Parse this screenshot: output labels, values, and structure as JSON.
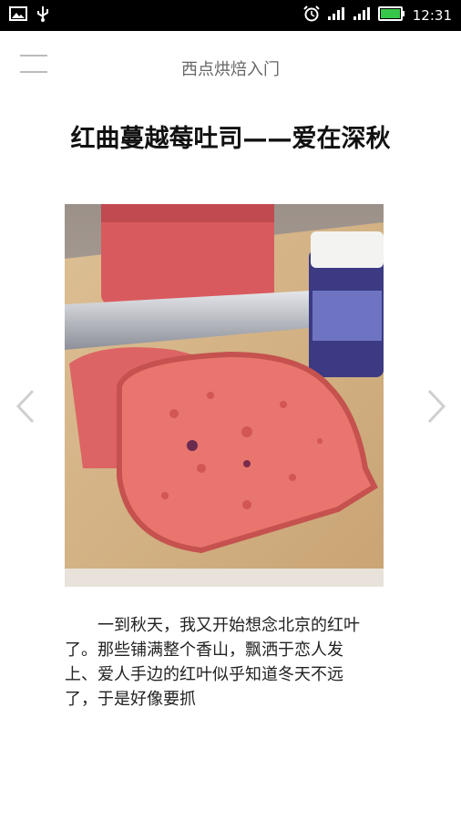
{
  "status_bar": {
    "time": "12:31",
    "icons": [
      "image-icon",
      "usb-icon",
      "alarm-icon",
      "signal-icon",
      "signal-icon",
      "battery-icon"
    ]
  },
  "header": {
    "menu_icon": "hamburger-menu-icon",
    "title": "西点烘焙入门"
  },
  "article": {
    "title": "红曲蔓越莓吐司——爱在深秋",
    "body": "一到秋天，我又开始想念北京的红叶了。那些铺满整个香山，飘洒于恋人发上、爱人手边的红叶似乎知道冬天不远了，于是好像要抓"
  },
  "colors": {
    "status_bar_bg": "#000000",
    "header_text": "#666666",
    "battery_green": "#36c64a",
    "bread_red": "#e0605f",
    "board_wood": "#d8b78a"
  }
}
